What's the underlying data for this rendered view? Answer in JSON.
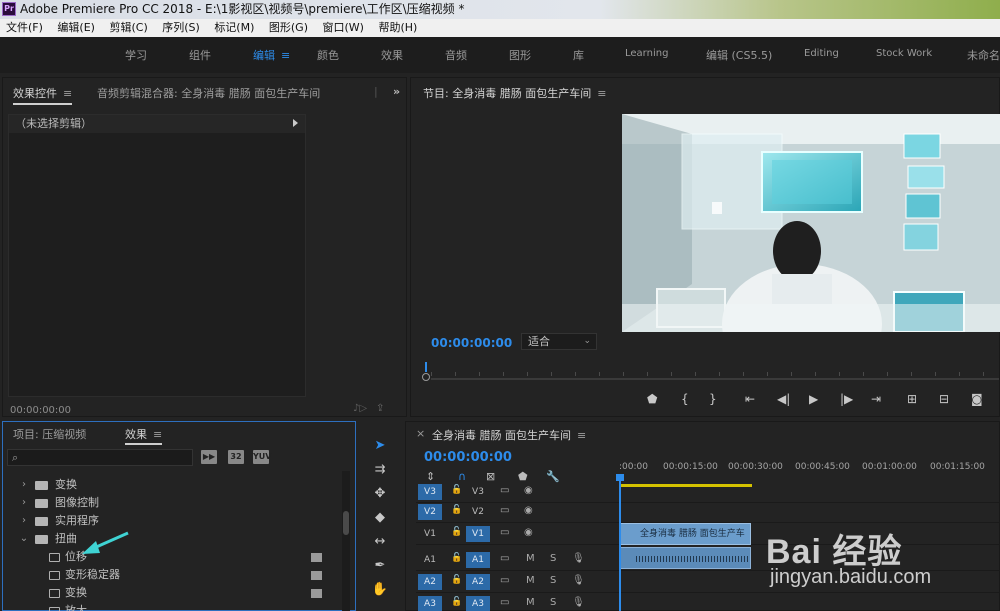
{
  "titlebar": {
    "title": "Adobe Premiere Pro CC 2018 - E:\\1影视区\\视频号\\premiere\\工作区\\压缩视频 *",
    "app_icon": "Pr"
  },
  "menu": [
    "文件(F)",
    "编辑(E)",
    "剪辑(C)",
    "序列(S)",
    "标记(M)",
    "图形(G)",
    "窗口(W)",
    "帮助(H)"
  ],
  "workspaces": [
    "学习",
    "组件",
    "编辑",
    "颜色",
    "效果",
    "音频",
    "图形",
    "库",
    "Learning",
    "编辑 (CS5.5)",
    "Editing",
    "Stock Work",
    "未命名"
  ],
  "active_workspace": "编辑",
  "effect_controls": {
    "tab_active": "效果控件",
    "tab_other": "音频剪辑混合器: 全身消毒 腊肠 面包生产车间",
    "no_clip": "（未选择剪辑）",
    "timecode": "00:00:00:00"
  },
  "program": {
    "title": "节目: 全身消毒 腊肠 面包生产车间",
    "timecode": "00:00:00:00",
    "fit": "适合",
    "playhead_fraction": 0
  },
  "project": {
    "tab_project": "项目: 压缩视频",
    "tab_effects": "效果",
    "search_placeholder": "",
    "buttons": [
      "32",
      "YUV"
    ],
    "tree": [
      {
        "label": "变换",
        "kind": "folder",
        "open": false
      },
      {
        "label": "图像控制",
        "kind": "folder",
        "open": false
      },
      {
        "label": "实用程序",
        "kind": "folder",
        "open": false
      },
      {
        "label": "扭曲",
        "kind": "folder",
        "open": true
      },
      {
        "label": "位移",
        "kind": "effect"
      },
      {
        "label": "变形稳定器",
        "kind": "effect"
      },
      {
        "label": "变换",
        "kind": "effect"
      },
      {
        "label": "放大",
        "kind": "effect"
      }
    ]
  },
  "timeline": {
    "sequence_name": "全身消毒 腊肠 面包生产车间",
    "timecode": "00:00:00:00",
    "ruler": [
      ":00:00",
      "00:00:15:00",
      "00:00:30:00",
      "00:00:45:00",
      "00:01:00:00",
      "00:01:15:00"
    ],
    "tracks": [
      {
        "src": "V3",
        "tgt": "V3"
      },
      {
        "src": "V2",
        "tgt": "V2"
      },
      {
        "src": "V1",
        "tgt": "V1"
      },
      {
        "src": "A1",
        "tgt": "A1"
      },
      {
        "src": "A2",
        "tgt": "A2"
      },
      {
        "src": "A3",
        "tgt": "A3"
      }
    ],
    "clip_label": "全身消毒 腊肠 面包生产车",
    "mute": "M",
    "solo": "S"
  },
  "watermark": {
    "logo": "Bai 经验",
    "url": "jingyan.baidu.com"
  },
  "colors": {
    "accent": "#2d8ceb",
    "clip_video": "#6b9dcc",
    "clip_audio": "#5b8bb9",
    "workbar": "#d4c200"
  }
}
